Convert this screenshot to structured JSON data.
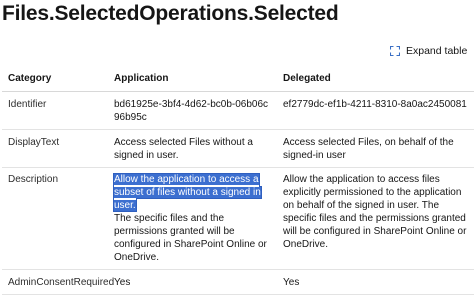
{
  "page": {
    "title": "Files.SelectedOperations.Selected"
  },
  "toolbar": {
    "expand_label": "Expand table"
  },
  "table": {
    "headers": [
      "Category",
      "Application",
      "Delegated"
    ],
    "rows": [
      {
        "category": "Identifier",
        "application": "bd61925e-3bf4-4d62-bc0b-06b06c96b95c",
        "delegated": "ef2779dc-ef1b-4211-8310-8a0ac2450081"
      },
      {
        "category": "DisplayText",
        "application": "Access selected Files without a signed in user.",
        "delegated": "Access selected Files, on behalf of the signed-in user"
      },
      {
        "category": "Description",
        "application_highlighted": "Allow the application to access a subset of files without a signed in user.",
        "application_rest": "The specific files and the permissions granted will be configured in SharePoint Online or OneDrive.",
        "delegated": "Allow the application to access files explicitly permissioned to the application on behalf of the signed in user. The specific files and the permissions granted will be configured in SharePoint Online or OneDrive."
      },
      {
        "category": "AdminConsentRequired",
        "application": "Yes",
        "delegated": "Yes"
      }
    ]
  },
  "icons": {
    "expand": "expand-icon"
  },
  "colors": {
    "selection_highlight": "#3c6fd0",
    "text": "#161616",
    "border": "#e3e3e3"
  }
}
